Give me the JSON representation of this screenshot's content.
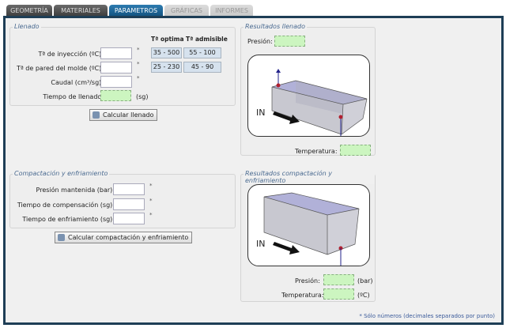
{
  "tabs": [
    {
      "label": "GEOMETRÍA"
    },
    {
      "label": "MATERIALES"
    },
    {
      "label": "PARAMETROS"
    },
    {
      "label": "GRÁFICAS"
    },
    {
      "label": "INFORMES"
    }
  ],
  "llenado": {
    "title": "Llenado",
    "col_optima": "Tª optima",
    "col_admisible": "Tª admisible",
    "rows": [
      {
        "label": "Tª de inyección (ºC):",
        "optima": "35 - 500",
        "admisible": "55 - 100"
      },
      {
        "label": "Tª de pared del molde (ºC):",
        "optima": "25 - 230",
        "admisible": "45 - 90"
      },
      {
        "label": "Caudal (cm³/sg):"
      }
    ],
    "tiempo_label": "Tiempo de llenado:",
    "tiempo_unit": "(sg)",
    "required": "*",
    "button": "Calcular llenado"
  },
  "res_llenado": {
    "title": "Resultados llenado",
    "presion_label": "Presión:",
    "temp_label": "Temperatura:",
    "in_label": "IN"
  },
  "compactacion": {
    "title": "Compactación y enfriamiento",
    "rows": [
      {
        "label": "Presión mantenida (bar):"
      },
      {
        "label": "Tiempo de compensación (sg):"
      },
      {
        "label": "Tiempo de enfriamiento (sg):"
      }
    ],
    "required": "*",
    "button": "Calcular compactación y enfriamiento"
  },
  "res_compactacion": {
    "title": "Resultados compactación y enfriamiento",
    "presion_label": "Presión:",
    "presion_unit": "(bar)",
    "temp_label": "Temperatura:",
    "temp_unit": "(ºC)",
    "in_label": "IN"
  },
  "footnote": "* Sólo números (decimales separados por punto)"
}
